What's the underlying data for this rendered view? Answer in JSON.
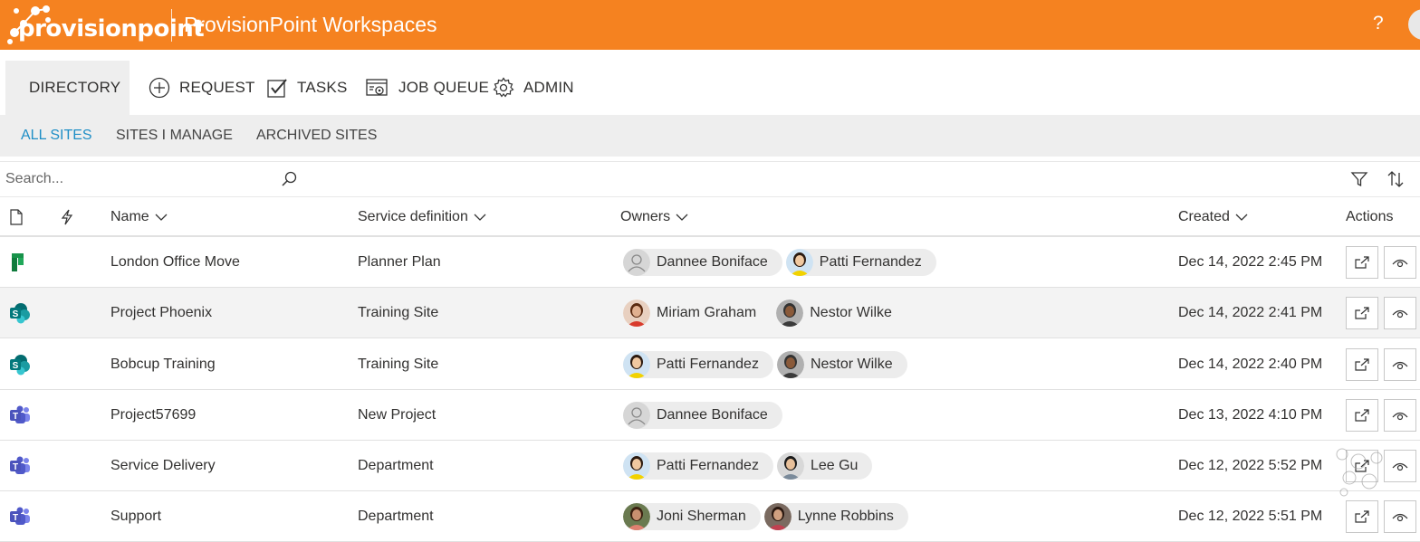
{
  "header": {
    "logo_text": "provisionpoint",
    "app_title": "ProvisionPoint Workspaces",
    "help_label": "?",
    "brand_color": "#f58220"
  },
  "nav": [
    {
      "label": "DIRECTORY",
      "icon": "list-icon",
      "active": true
    },
    {
      "label": "REQUEST",
      "icon": "plus-circle-icon"
    },
    {
      "label": "TASKS",
      "icon": "checkbox-icon"
    },
    {
      "label": "JOB QUEUE",
      "icon": "job-queue-icon"
    },
    {
      "label": "ADMIN",
      "icon": "gear-icon"
    }
  ],
  "subnav": [
    {
      "label": "ALL SITES",
      "active": true
    },
    {
      "label": "SITES I MANAGE"
    },
    {
      "label": "ARCHIVED SITES"
    }
  ],
  "search": {
    "placeholder": "Search..."
  },
  "columns": {
    "name": "Name",
    "service": "Service definition",
    "owners": "Owners",
    "created": "Created",
    "actions": "Actions"
  },
  "rows": [
    {
      "type": "planner",
      "name": "London Office Move",
      "service": "Planner Plan",
      "owners": [
        "Dannee Boniface",
        "Patti Fernandez"
      ],
      "created": "Dec 14, 2022 2:45 PM"
    },
    {
      "type": "sharepoint",
      "name": "Project Phoenix",
      "service": "Training Site",
      "owners": [
        "Miriam Graham",
        "Nestor Wilke"
      ],
      "created": "Dec 14, 2022 2:41 PM"
    },
    {
      "type": "sharepoint",
      "name": "Bobcup Training",
      "service": "Training Site",
      "owners": [
        "Patti Fernandez",
        "Nestor Wilke"
      ],
      "created": "Dec 14, 2022 2:40 PM"
    },
    {
      "type": "teams",
      "name": "Project57699",
      "service": "New Project",
      "owners": [
        "Dannee Boniface"
      ],
      "created": "Dec 13, 2022 4:10 PM"
    },
    {
      "type": "teams",
      "name": "Service Delivery",
      "service": "Department",
      "owners": [
        "Patti Fernandez",
        "Lee Gu"
      ],
      "created": "Dec 12, 2022 5:52 PM"
    },
    {
      "type": "teams",
      "name": "Support",
      "service": "Department",
      "owners": [
        "Joni Sherman",
        "Lynne Robbins"
      ],
      "created": "Dec 12, 2022 5:51 PM"
    }
  ]
}
